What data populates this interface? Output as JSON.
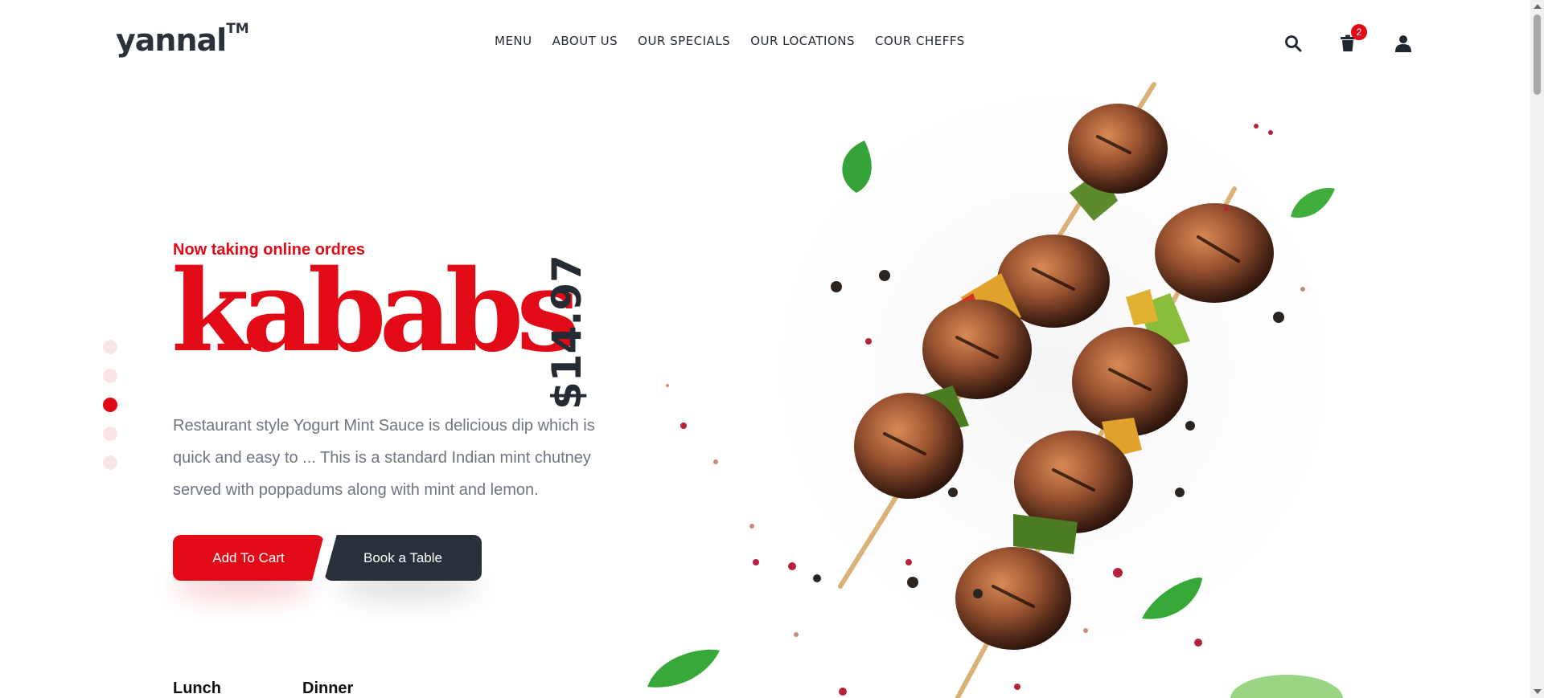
{
  "brand": {
    "name": "yannal",
    "mark": "TM"
  },
  "nav": {
    "items": [
      {
        "label": "MENU"
      },
      {
        "label": "ABOUT US"
      },
      {
        "label": "OUR SPECIALS"
      },
      {
        "label": "OUR LOCATIONS"
      },
      {
        "label": "COUR CHEFFS"
      }
    ]
  },
  "header_icons": {
    "search": "search-icon",
    "cart": "trash-bin-icon",
    "cart_count": "2",
    "account": "user-icon"
  },
  "slider": {
    "dot_count": 5,
    "active_index": 2
  },
  "hero": {
    "eyebrow": "Now taking online ordres",
    "title": "kababs",
    "price": "$14.97",
    "description": "Restaurant style Yogurt Mint Sauce is delicious dip which is quick and easy to ... This is a standard Indian mint chutney served with poppadums along with mint and lemon."
  },
  "buttons": {
    "add_to_cart": "Add To Cart",
    "book_table": "Book a Table"
  },
  "hours": {
    "lunch": "Lunch",
    "dinner": "Dinner"
  },
  "colors": {
    "accent": "#e20a16",
    "dark": "#28303b",
    "text_muted": "#6f7580",
    "dot_inactive": "#fbe4e5"
  }
}
